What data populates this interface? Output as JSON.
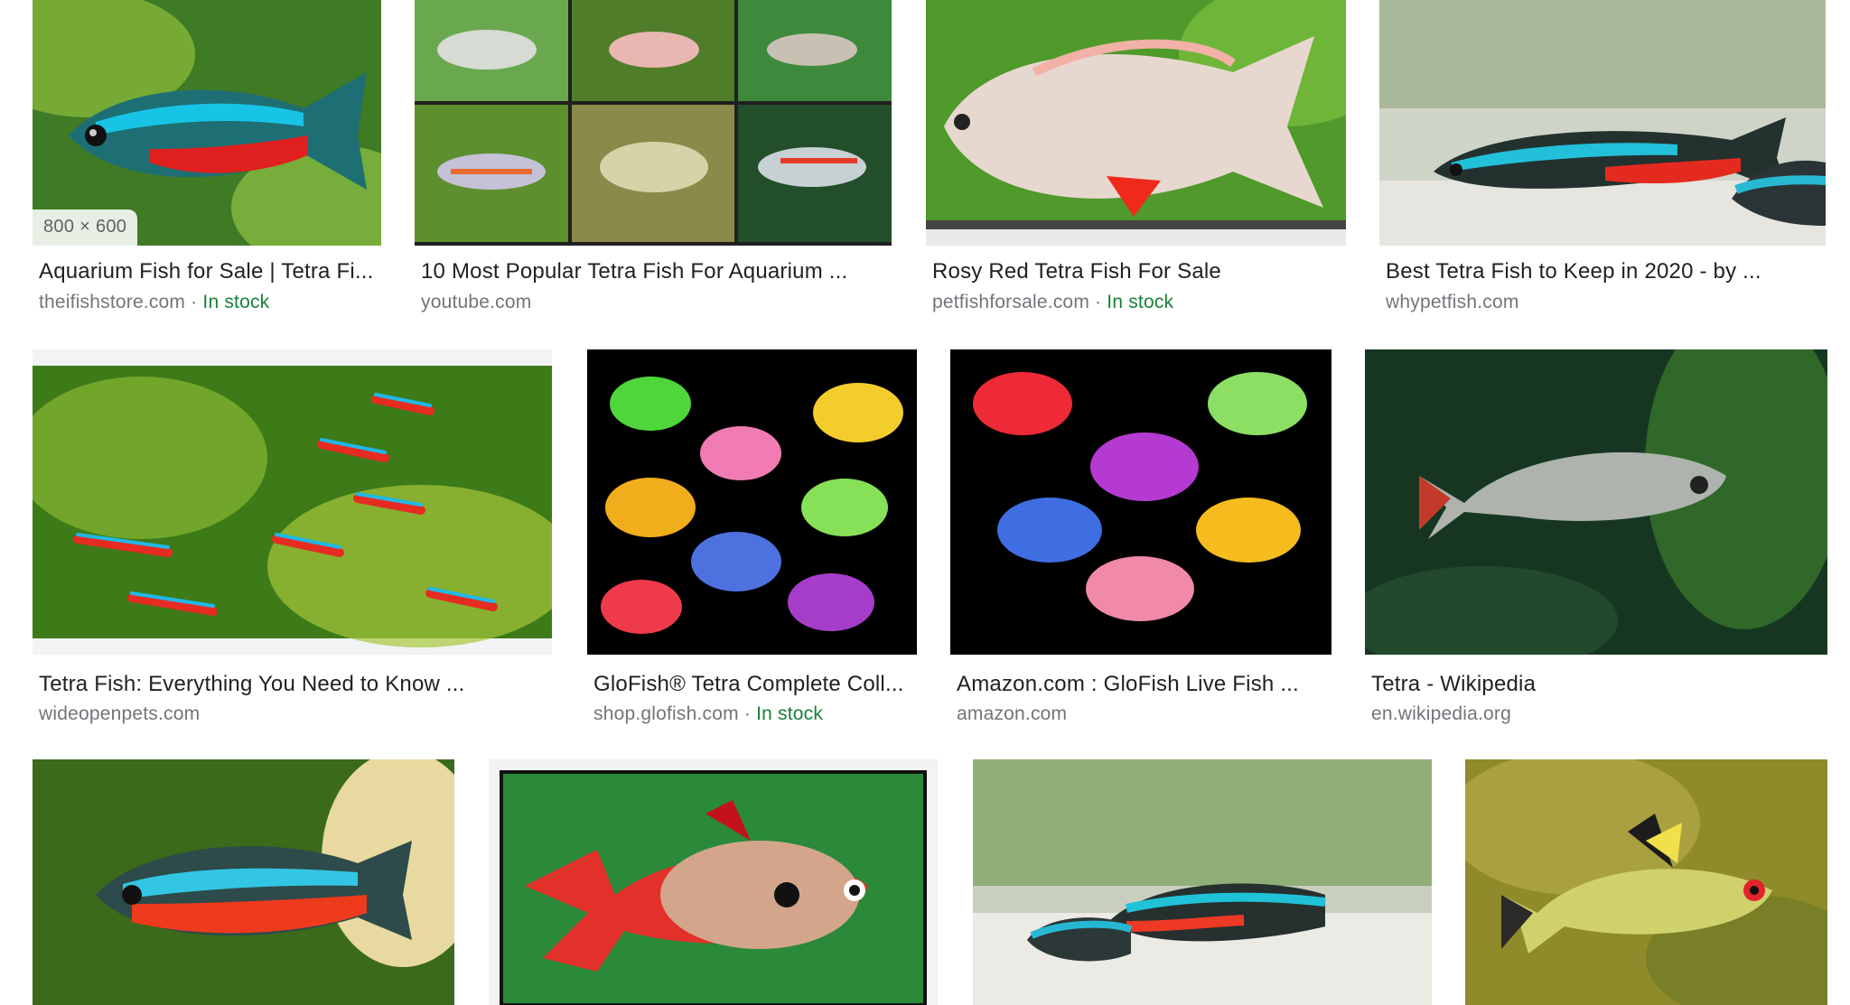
{
  "results": [
    {
      "title": "Aquarium Fish for Sale | Tetra Fi...",
      "domain": "theifishstore.com",
      "stock": "In stock",
      "badge": "800 × 600",
      "image": "neon-tetra-closeup"
    },
    {
      "title": "10 Most Popular Tetra Fish For Aquarium ...",
      "domain": "youtube.com",
      "stock": "",
      "image": "tetra-collage"
    },
    {
      "title": "Rosy Red Tetra Fish For Sale",
      "domain": "petfishforsale.com",
      "stock": "In stock",
      "image": "rosy-red-tetra"
    },
    {
      "title": "Best Tetra Fish to Keep in 2020 - by ...",
      "domain": "whypetfish.com",
      "stock": "",
      "image": "two-neon-tetras"
    },
    {
      "title": "Tetra Fish: Everything You Need to Know ...",
      "domain": "wideopenpets.com",
      "stock": "",
      "image": "tetra-school-plants"
    },
    {
      "title": "GloFish® Tetra Complete Coll...",
      "domain": "shop.glofish.com",
      "stock": "In stock",
      "image": "glofish-collection"
    },
    {
      "title": "Amazon.com : GloFish Live Fish ...",
      "domain": "amazon.com",
      "stock": "",
      "image": "glofish-amazon"
    },
    {
      "title": "Tetra - Wikipedia",
      "domain": "en.wikipedia.org",
      "stock": "",
      "image": "silver-tetra"
    },
    {
      "title": "",
      "domain": "",
      "stock": "",
      "image": "cardinal-tetra-snail"
    },
    {
      "title": "",
      "domain": "",
      "stock": "",
      "image": "serpae-tetra"
    },
    {
      "title": "",
      "domain": "",
      "stock": "",
      "image": "neon-tetras-gravel"
    },
    {
      "title": "",
      "domain": "",
      "stock": "",
      "image": "lemon-tetra"
    }
  ],
  "colors": {
    "title": "#202124",
    "meta": "#70757a",
    "stock": "#188038"
  }
}
